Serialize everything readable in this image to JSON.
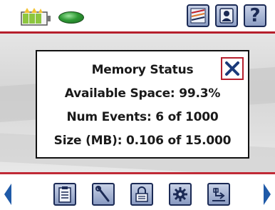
{
  "dialog": {
    "title": "Memory Status",
    "available_space": "Available Space: 99.3%",
    "num_events": "Num Events: 6 of 1000",
    "size": "Size (MB): 0.106 of 15.000"
  },
  "top_bar": {
    "help_label": "?"
  },
  "colors": {
    "accent_red": "#b61f2c",
    "button_navy": "#1b2a55",
    "arrow_blue": "#1f5aa8",
    "status_green": "#2f9a35"
  },
  "icons": {
    "top": [
      "battery-icon",
      "status-led-icon",
      "chart-icon",
      "contacts-icon",
      "help-icon"
    ],
    "dialog": [
      "close-icon"
    ],
    "bottom": [
      "left-arrow-icon",
      "clipboard-icon",
      "wrench-icon",
      "lock-icon",
      "gear-icon",
      "transfer-icon",
      "right-arrow-icon"
    ]
  }
}
